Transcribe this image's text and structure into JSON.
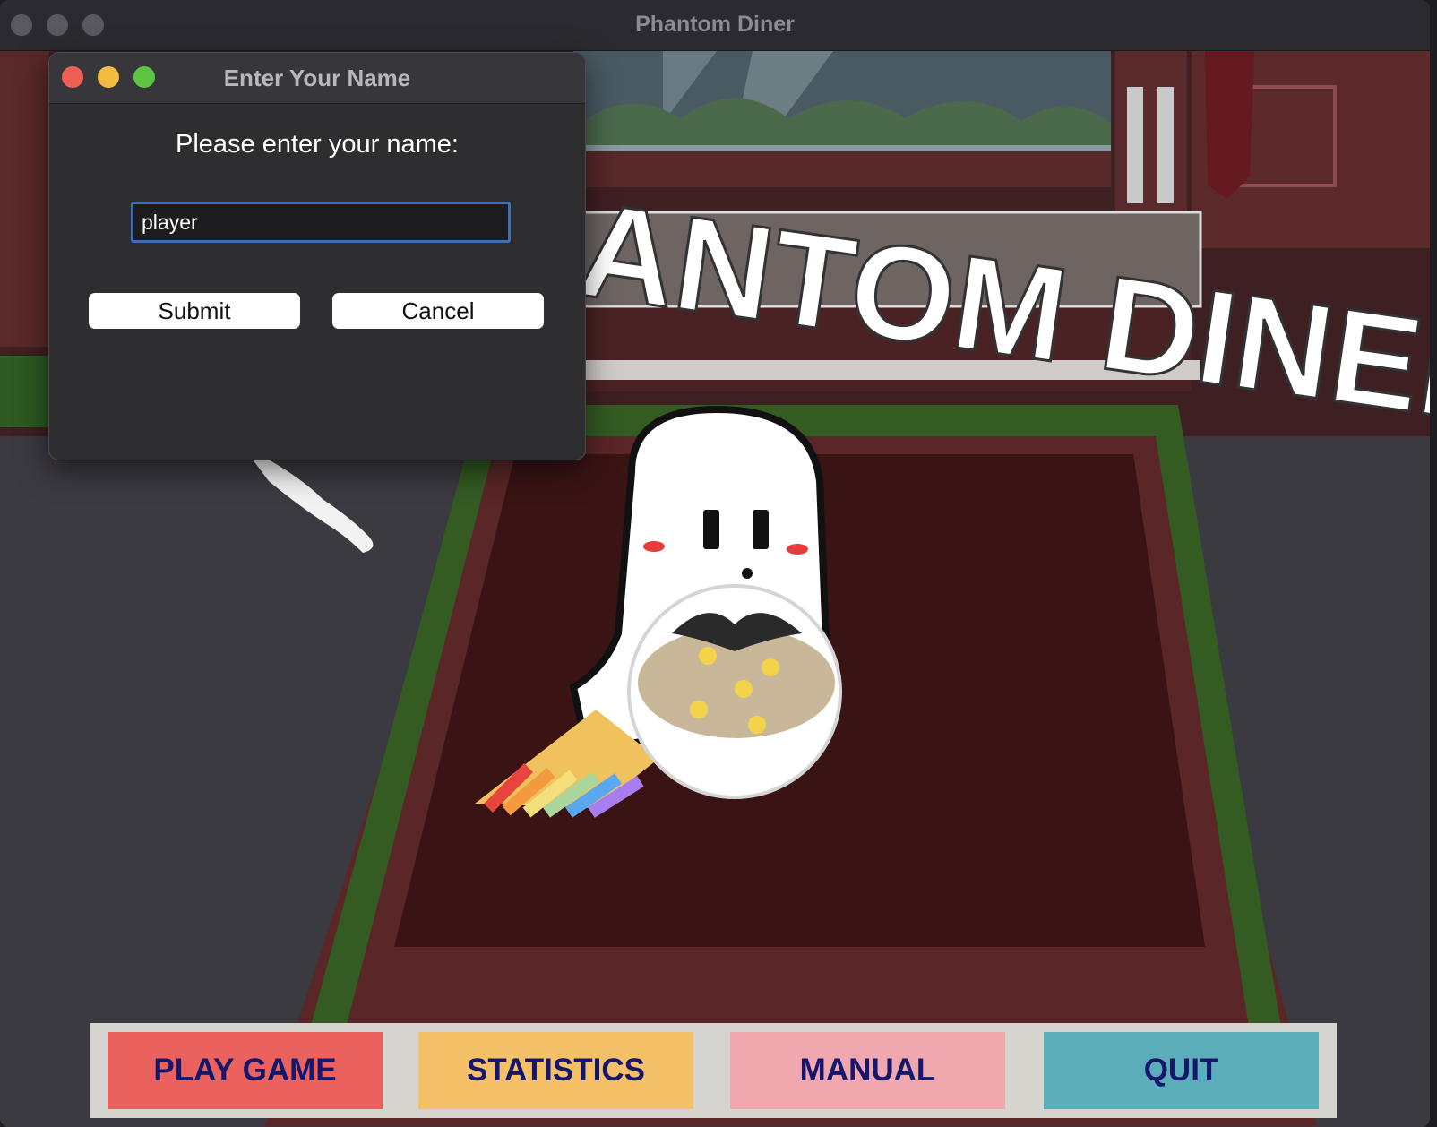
{
  "window": {
    "title": "Phantom Diner"
  },
  "dialog": {
    "title": "Enter Your Name",
    "prompt": "Please enter your name:",
    "name_value": "player",
    "submit_label": "Submit",
    "cancel_label": "Cancel"
  },
  "menu": {
    "play_label": "PLAY GAME",
    "stats_label": "STATISTICS",
    "manual_label": "MANUAL",
    "quit_label": "QUIT"
  },
  "logo": {
    "text": "PHANTOM DINER"
  },
  "colors": {
    "play": "#ea615e",
    "stats": "#f4c168",
    "manual": "#f0a7ae",
    "quit": "#5baeb9",
    "button_text": "#16166c",
    "input_focus": "#3d6fb8"
  }
}
